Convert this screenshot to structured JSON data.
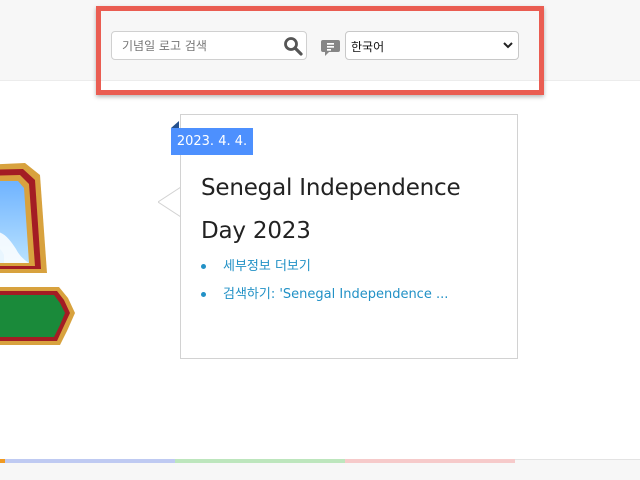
{
  "header": {
    "search": {
      "placeholder": "기념일 로고 검색",
      "icon": "search-icon"
    },
    "language": {
      "icon": "speech-bubble-icon",
      "selected_value": "한국어"
    }
  },
  "card": {
    "date": "2023. 4. 4.",
    "title_line1": "Senegal Independence",
    "title_line2": "Day 2023",
    "links": [
      "세부정보 더보기",
      "검색하기: 'Senegal Independence ..."
    ]
  },
  "progress_segments": {
    "orange": "#f09a22",
    "blue": "#bfcaf2",
    "green": "#bde6bd",
    "red": "#f6caca"
  },
  "colors": {
    "highlight_border": "#ea5d52",
    "date_badge": "#4d90fe",
    "link": "#2291c6"
  }
}
